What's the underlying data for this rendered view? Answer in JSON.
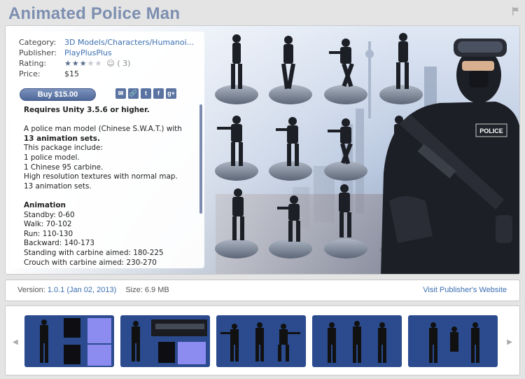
{
  "title": "Animated Police Man",
  "meta": {
    "category_label": "Category:",
    "category_value": "3D Models/Characters/Humanoi...",
    "publisher_label": "Publisher:",
    "publisher_value": "PlayPlusPlus",
    "rating_label": "Rating:",
    "rating_stars": 3,
    "rating_max": 5,
    "rating_count": "( 3)",
    "price_label": "Price:",
    "price_value": "$15"
  },
  "buy_label": "Buy $15.00",
  "share_icons": [
    "share-icon",
    "link-icon",
    "twitter-icon",
    "facebook-icon",
    "google-plus-icon"
  ],
  "description": {
    "requires": "Requires Unity 3.5.6 or higher.",
    "intro": "A police man model (Chinese S.W.A.T.) with",
    "anim_sets": "13 animation sets",
    "lines": [
      "This package include:",
      "1 police model.",
      "1 Chinese 95 carbine.",
      "High resolution textures with normal map.",
      "13 animation sets."
    ],
    "animation_heading": "Animation",
    "animations": [
      "Standby: 0-60",
      "Walk: 70-102",
      "Run: 110-130",
      "Backward: 140-173",
      "Standing with carbine aimed: 180-225",
      "Crouch with carbine aimed: 230-270"
    ]
  },
  "hero_badge": "POLICE",
  "version_label": "Version:",
  "version_value": "1.0.1 (Jan 02, 2013)",
  "size_text": "Size: 6.9 MB",
  "publisher_link": "Visit Publisher's Website",
  "colors": {
    "accent": "#5a6d8e",
    "link": "#3b6fb0",
    "title": "#7d8fb0",
    "hero_blue": "#2b4b8e"
  }
}
